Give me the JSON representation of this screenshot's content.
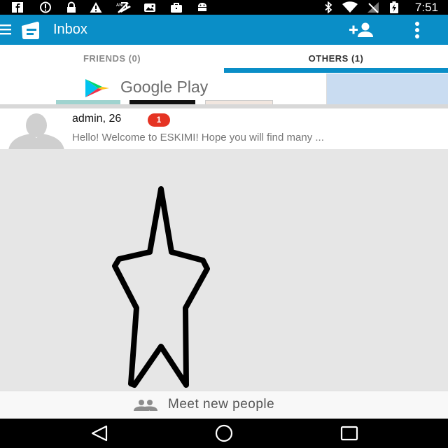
{
  "status_bar": {
    "time": "7:51",
    "icons": [
      "facebook-icon",
      "alert-circle-icon",
      "lock-icon",
      "warning-icon",
      "no-sim-icon",
      "photo-icon",
      "briefcase-icon",
      "android-icon",
      "bluetooth-icon",
      "wifi-icon",
      "signal-icon",
      "battery-charging-icon"
    ]
  },
  "app_bar": {
    "title": "Inbox",
    "icons": [
      "menu-icon",
      "eskimi-logo-icon",
      "add-friend-icon",
      "more-vertical-icon"
    ]
  },
  "tabs": [
    {
      "label": "FRIENDS (0)",
      "selected": false
    },
    {
      "label": "OTHERS (1)",
      "selected": true
    }
  ],
  "ad": {
    "text": "Google Play",
    "icon": "google-play-logo-icon"
  },
  "conversation": {
    "sender": "admin, 26",
    "unread_count": "1",
    "preview": "Hello! Welcome to ESKIMI! Hope you will find many ..."
  },
  "bottom_action": {
    "label": "Meet new people",
    "icon": "people-icon"
  },
  "nav_bar": {
    "icons": [
      "back-icon",
      "home-icon",
      "recents-icon"
    ]
  },
  "colors": {
    "app_bar": "#0a8ec7",
    "tab_indicator": "#0a8ec7",
    "badge": "#e53323",
    "background": "#e6e6e6"
  }
}
